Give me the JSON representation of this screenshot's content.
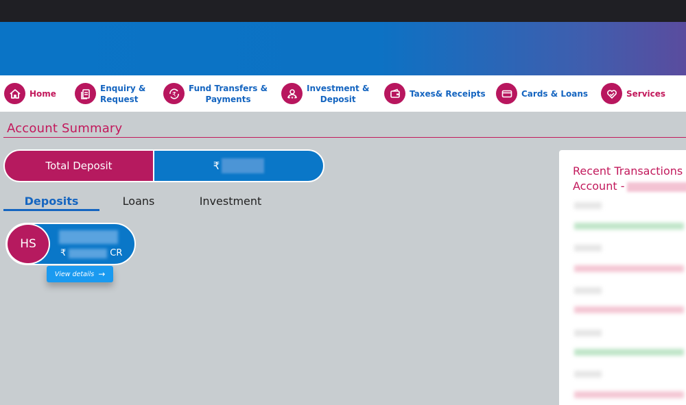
{
  "nav": {
    "items": [
      {
        "label": "Home",
        "icon": "home-icon",
        "color": "magenta"
      },
      {
        "label": "Enquiry &\nRequest",
        "icon": "document-icon",
        "color": "blue"
      },
      {
        "label": "Fund Transfers &\nPayments",
        "icon": "rupee-transfer-icon",
        "color": "blue"
      },
      {
        "label": "Investment &\nDeposit",
        "icon": "investor-icon",
        "color": "blue"
      },
      {
        "label": "Taxes& Receipts",
        "icon": "wallet-icon",
        "color": "blue"
      },
      {
        "label": "Cards & Loans",
        "icon": "card-icon",
        "color": "blue"
      },
      {
        "label": "Services",
        "icon": "heart-check-icon",
        "color": "magenta"
      }
    ]
  },
  "page": {
    "title": "Account Summary"
  },
  "summary": {
    "label": "Total Deposit",
    "currency": "₹"
  },
  "tabs": [
    {
      "label": "Deposits",
      "active": true
    },
    {
      "label": "Loans",
      "active": false
    },
    {
      "label": "Investment",
      "active": false
    }
  ],
  "account": {
    "initials": "HS",
    "currency": "₹",
    "suffix": "CR",
    "view_details": "View details"
  },
  "recent": {
    "title_line1": "Recent Transactions fo",
    "title_line2": "Account -"
  },
  "colors": {
    "magenta": "#b61a5f",
    "blue": "#0a77c8",
    "accent_text": "#c2185b",
    "background": "#c8cdd0"
  }
}
